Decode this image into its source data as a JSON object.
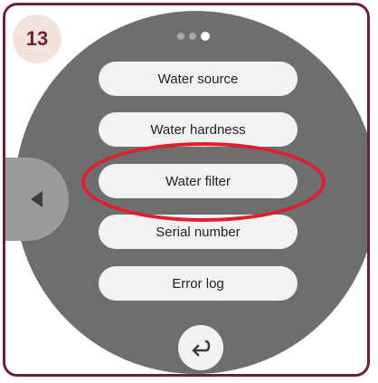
{
  "step_badge": {
    "number": "13"
  },
  "pagination": {
    "total": 3,
    "active_index": 2
  },
  "menu": {
    "items": [
      {
        "label": "Water source"
      },
      {
        "label": "Water hardness"
      },
      {
        "label": "Water filter",
        "highlighted": true
      },
      {
        "label": "Serial number"
      },
      {
        "label": "Error log"
      }
    ]
  },
  "controls": {
    "side_button_icon": "triangle-left-icon",
    "back_button_icon": "return-arrow-icon"
  },
  "colors": {
    "frame_border": "#6a2239",
    "badge_bg": "#f3e3dd",
    "dial_bg": "#6e6e70",
    "pill_bg": "#f2f2f0",
    "highlight": "#e01f2d"
  }
}
